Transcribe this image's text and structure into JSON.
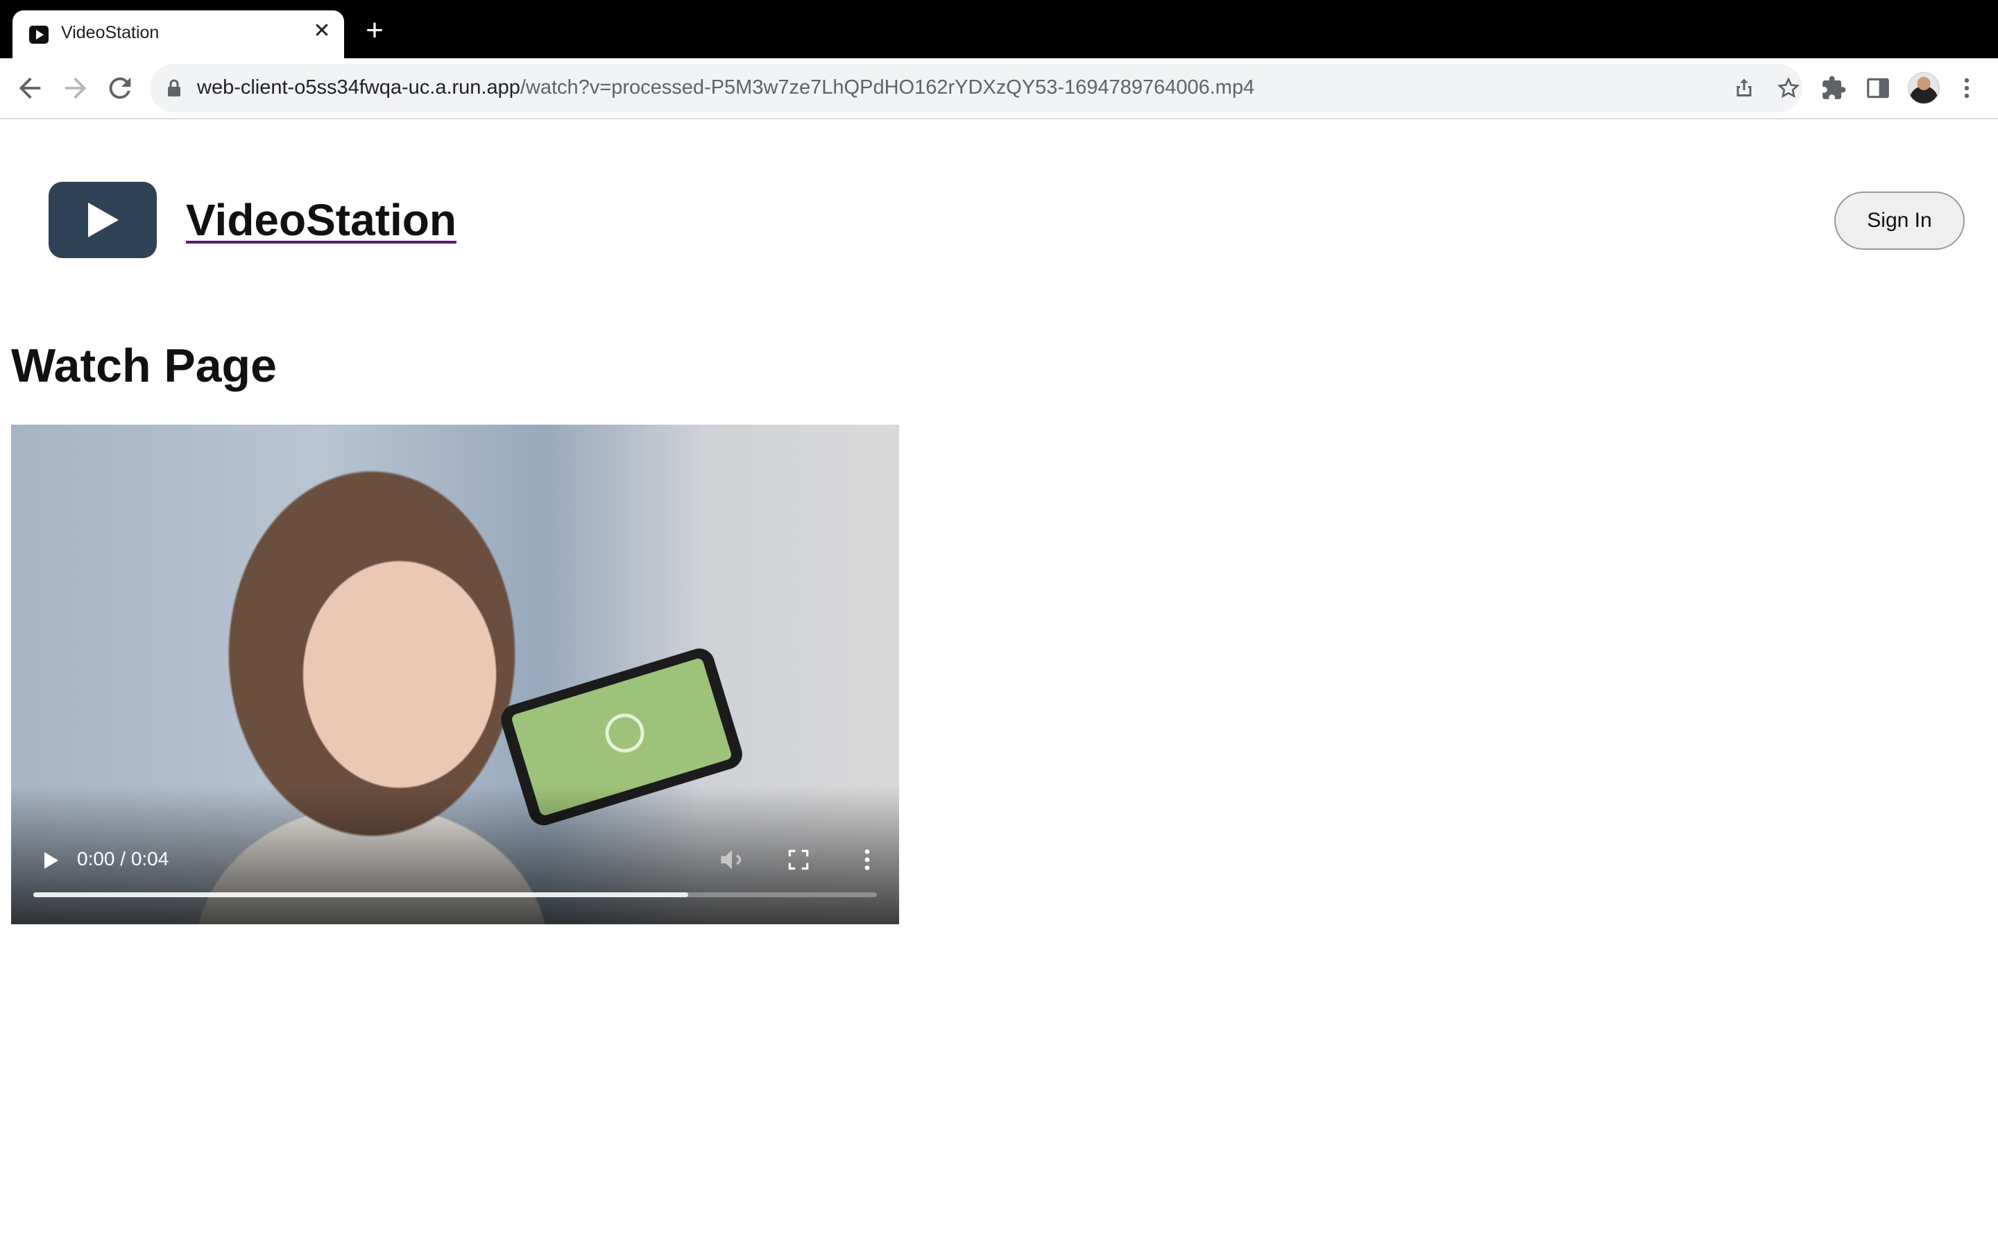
{
  "browser": {
    "tab_title": "VideoStation",
    "tab_close": "✕",
    "new_tab": "+",
    "url_host": "web-client-o5ss34fwqa-uc.a.run.app",
    "url_path": "/watch?v=processed-P5M3w7ze7LhQPdHO162rYDXzQY53-1694789764006.mp4"
  },
  "header": {
    "brand": "VideoStation",
    "sign_in": "Sign In"
  },
  "page": {
    "heading": "Watch Page"
  },
  "player": {
    "time": "0:00 / 0:04",
    "buffered_fraction": 0.776
  }
}
